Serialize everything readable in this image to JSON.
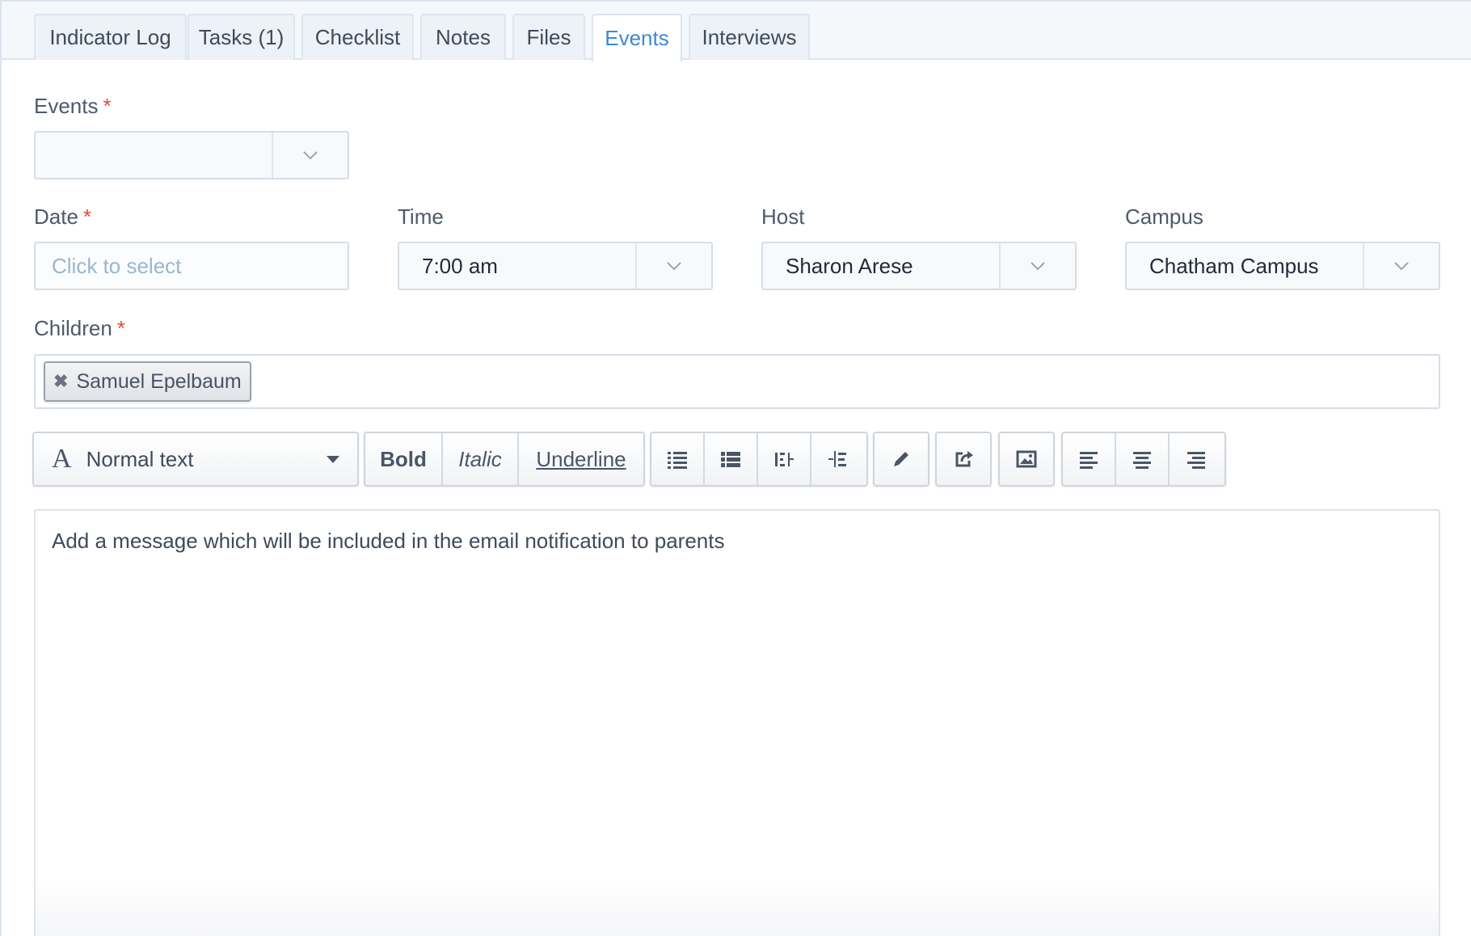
{
  "tabs": [
    {
      "label": "Indicator Log",
      "active": false
    },
    {
      "label": "Tasks (1)",
      "active": false
    },
    {
      "label": "Checklist",
      "active": false
    },
    {
      "label": "Notes",
      "active": false
    },
    {
      "label": "Files",
      "active": false
    },
    {
      "label": "Events",
      "active": true
    },
    {
      "label": "Interviews",
      "active": false
    }
  ],
  "form": {
    "events": {
      "label": "Events",
      "required_mark": "*",
      "value": ""
    },
    "date": {
      "label": "Date",
      "required_mark": "*",
      "placeholder": "Click to select"
    },
    "time": {
      "label": "Time",
      "value": "7:00 am"
    },
    "host": {
      "label": "Host",
      "value": "Sharon Arese"
    },
    "campus": {
      "label": "Campus",
      "value": "Chatham Campus"
    },
    "children": {
      "label": "Children",
      "required_mark": "*",
      "tags": [
        "Samuel Epelbaum"
      ],
      "remove_glyph": "✖"
    }
  },
  "toolbar": {
    "format_select": {
      "glyph": "A",
      "label": "Normal text"
    },
    "bold": "Bold",
    "italic": "Italic",
    "underline": "Underline",
    "icons": [
      "unordered-list-icon",
      "ordered-list-icon",
      "outdent-icon",
      "indent-icon",
      "pencil-icon",
      "link-icon",
      "image-icon",
      "align-left-icon",
      "align-center-icon",
      "align-right-icon"
    ]
  },
  "editor": {
    "placeholder": "Add a message which will be included in the email notification to parents"
  },
  "colors": {
    "active_tab": "#3f89d3",
    "required": "#e04a3f",
    "placeholder": "#9ab6cf"
  }
}
